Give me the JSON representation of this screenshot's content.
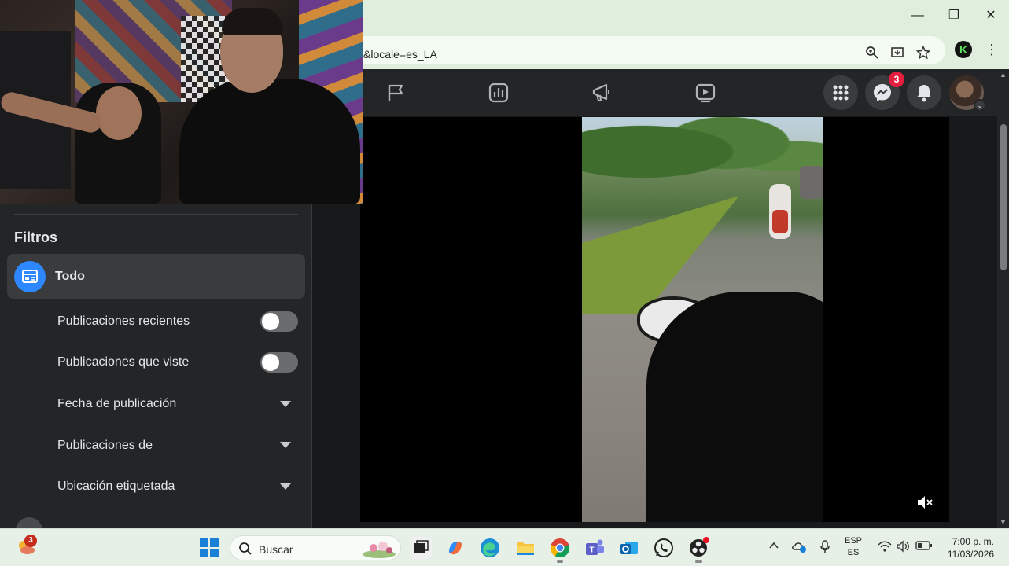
{
  "browser": {
    "url_fragment": "&locale=es_LA",
    "window_controls": {
      "minimize": "—",
      "maximize": "❐",
      "close": "✕"
    },
    "profile_initial": "K"
  },
  "fb_header": {
    "nav_icons": [
      "flag-icon",
      "insights-icon",
      "megaphone-icon",
      "video-icon"
    ],
    "messenger_badge": "3",
    "colors": {
      "badge": "#e41e3f",
      "accent": "#2d88ff"
    }
  },
  "filters": {
    "title": "Filtros",
    "active": "Todo",
    "toggles": [
      {
        "label": "Publicaciones recientes",
        "on": false
      },
      {
        "label": "Publicaciones que viste",
        "on": false
      }
    ],
    "dropdowns": [
      {
        "label": "Fecha de publicación"
      },
      {
        "label": "Publicaciones de"
      },
      {
        "label": "Ubicación etiquetada"
      }
    ]
  },
  "video": {
    "muted": true
  },
  "taskbar": {
    "weather_badge": "3",
    "search_placeholder": "Buscar",
    "lang_top": "ESP",
    "lang_bottom": "ES",
    "time": "7:00 p. m.",
    "date": "11/03/2026"
  }
}
